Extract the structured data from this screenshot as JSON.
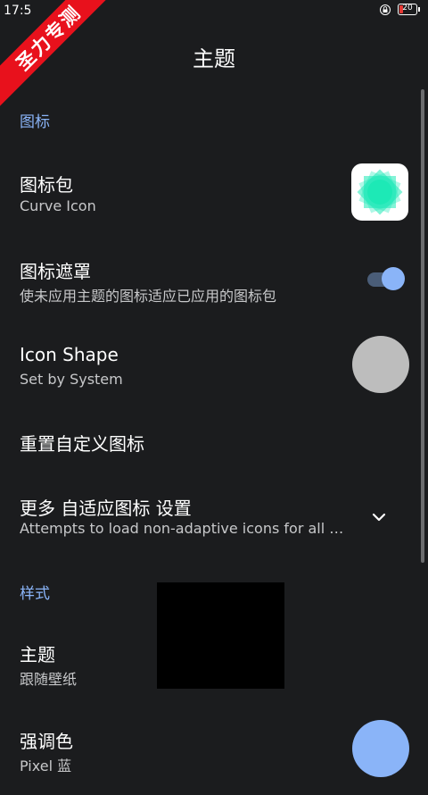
{
  "status": {
    "time": "17:5",
    "battery": "20"
  },
  "watermark": "圣力专测",
  "header": {
    "title": "主题"
  },
  "sections": {
    "icons": {
      "label": "图标"
    },
    "style": {
      "label": "样式"
    }
  },
  "rows": {
    "icon_pack": {
      "title": "图标包",
      "subtitle": "Curve Icon"
    },
    "icon_mask": {
      "title": "图标遮罩",
      "subtitle": "使未应用主题的图标适应已应用的图标包",
      "enabled": true
    },
    "icon_shape": {
      "title": "Icon Shape",
      "subtitle": "Set by System"
    },
    "reset_icons": {
      "title": "重置自定义图标"
    },
    "more_adaptive": {
      "title": "更多 自适应图标 设置",
      "subtitle": "Attempts to load non-adaptive icons for all apps"
    },
    "theme": {
      "title": "主题",
      "subtitle": "跟随壁纸"
    },
    "accent": {
      "title": "强调色",
      "subtitle": "Pixel 蓝"
    }
  },
  "colors": {
    "background": "#1b1c1e",
    "accent": "#8ab4f8",
    "icon_pack_fill": "#1de9b6",
    "shape_preview": "#bdbdbd"
  }
}
